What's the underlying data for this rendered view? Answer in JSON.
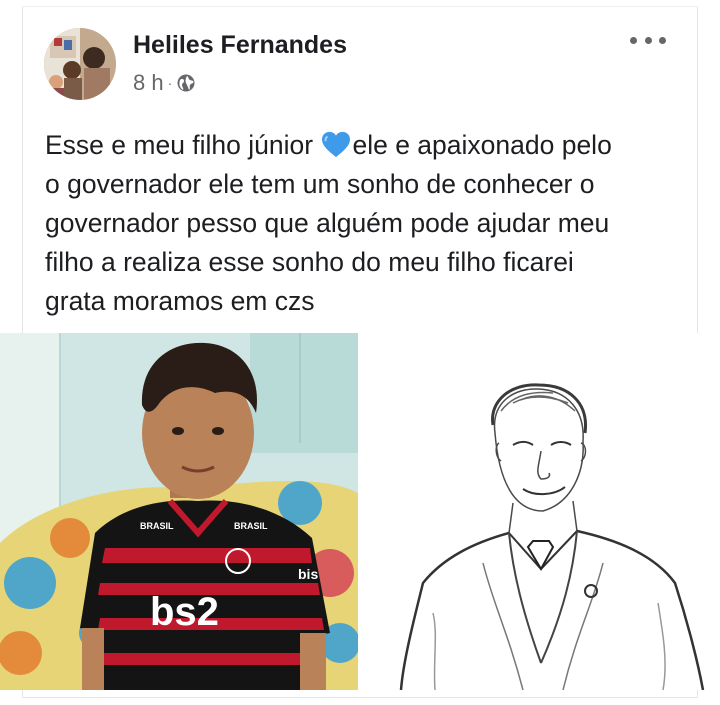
{
  "post": {
    "author": "Heliles Fernandes",
    "time": "8 h",
    "separator": "·",
    "privacy_icon": "globe-icon",
    "more_icon": "more-options-icon",
    "text_lines": [
      "Esse e meu filho júnior",
      "ele e apaixonado pelo",
      "o governador ele tem um sonho de conhecer o",
      "governador pesso que alguém pode ajudar meu",
      "filho a realiza esse sonho do meu filho ficarei",
      "grata moramos em czs"
    ],
    "emoji": "blue-heart-icon"
  },
  "photos": {
    "left": {
      "jersey_text": "bs2",
      "sleeve_text": "bis",
      "chest_left": "BRASIL",
      "chest_right": "BRASIL"
    },
    "right": {
      "style": "pencil-sketch"
    }
  },
  "colors": {
    "text": "#1c1e21",
    "secondary": "#65676b",
    "heart": "#3d9be9",
    "jersey_red": "#c0182c",
    "jersey_black": "#141414"
  }
}
